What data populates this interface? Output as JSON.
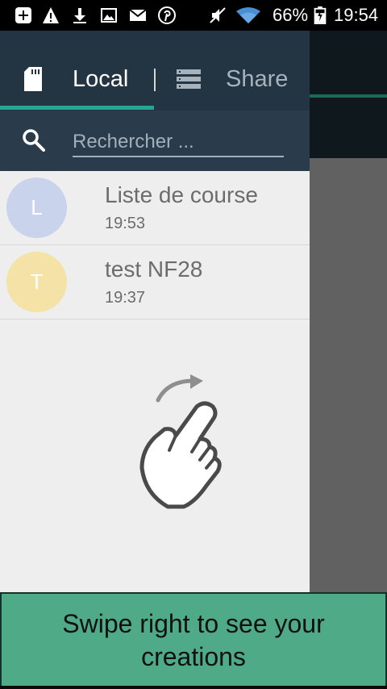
{
  "status_bar": {
    "battery": "66%",
    "time": "19:54",
    "left_icons": [
      "notification-plus-icon",
      "warning-icon",
      "download-icon",
      "image-icon",
      "mail-icon",
      "pinterest-icon"
    ],
    "right_icons": [
      "mute-icon",
      "wifi-icon",
      "battery-icon"
    ]
  },
  "tabs": {
    "local": {
      "label": "Local",
      "icon": "sd-card-icon"
    },
    "share": {
      "label": "Share",
      "icon": "list-icon"
    }
  },
  "search": {
    "placeholder": "Rechercher ..."
  },
  "items": [
    {
      "initial": "L",
      "title": "Liste de course",
      "time": "19:53",
      "avatar_color": "#c9d3ec"
    },
    {
      "initial": "T",
      "title": "test NF28",
      "time": "19:37",
      "avatar_color": "#f4e2a6"
    }
  ],
  "gesture": {
    "icon": "swipe-hand-icon"
  },
  "banner": {
    "text": "Swipe right to see your creations"
  },
  "colors": {
    "accent": "#26a592",
    "tab_bar": "#233443",
    "banner": "#4fab87"
  }
}
